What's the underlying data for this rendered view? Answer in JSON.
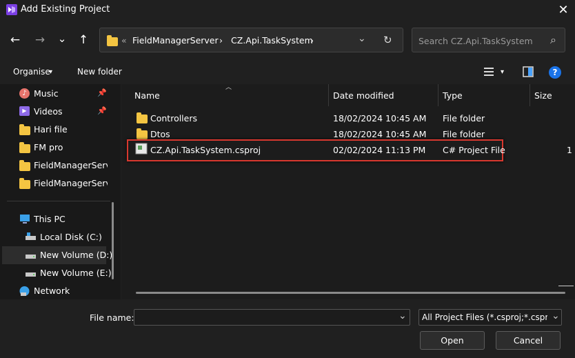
{
  "window": {
    "title": "Add Existing Project",
    "close_glyph": "✕"
  },
  "nav": {
    "back": "←",
    "forward": "→",
    "recent": "⌄",
    "up": "↑"
  },
  "address": {
    "overflow": "«",
    "crumbs": [
      "FieldManagerServer",
      "CZ.Api.TaskSystem"
    ],
    "separator": "›",
    "dropdown_glyph": "⌄",
    "refresh_glyph": "↻"
  },
  "search": {
    "placeholder": "Search CZ.Api.TaskSystem",
    "icon_glyph": "⌕"
  },
  "toolbar": {
    "organise": "Organise",
    "organise_caret": "▾",
    "new_folder": "New folder",
    "view_caret": "▾",
    "help": "?"
  },
  "sidebar": {
    "quick": [
      {
        "label": "Music",
        "icon": "music-icon",
        "pinned": true
      },
      {
        "label": "Videos",
        "icon": "videos-icon",
        "pinned": true
      },
      {
        "label": "Hari file",
        "icon": "folder-icon",
        "pinned": false
      },
      {
        "label": "FM pro",
        "icon": "folder-icon",
        "pinned": false
      },
      {
        "label": "FieldManagerServ",
        "icon": "folder-icon",
        "pinned": false
      },
      {
        "label": "FieldManagerServ",
        "icon": "folder-icon",
        "pinned": false
      }
    ],
    "this_pc": "This PC",
    "drives": [
      {
        "label": "Local Disk (C:)",
        "selected": false
      },
      {
        "label": "New Volume (D:)",
        "selected": true
      },
      {
        "label": "New Volume (E:)",
        "selected": false
      }
    ],
    "network": "Network"
  },
  "columns": {
    "name": "Name",
    "date": "Date modified",
    "type": "Type",
    "size": "Size"
  },
  "files": [
    {
      "name": "Controllers",
      "date": "18/02/2024 10:45 AM",
      "type": "File folder",
      "size": "",
      "icon": "folder-icon"
    },
    {
      "name": "Dtos",
      "date": "18/02/2024 10:45 AM",
      "type": "File folder",
      "size": "",
      "icon": "folder-icon"
    },
    {
      "name": "CZ.Api.TaskSystem.csproj",
      "date": "02/02/2024 11:13 PM",
      "type": "C# Project File",
      "size": "1",
      "icon": "csproj-file-icon",
      "highlighted": true
    }
  ],
  "footer": {
    "file_name_label": "File name:",
    "file_name_value": "",
    "filter": "All Project Files (*.csproj;*.csproj",
    "dropdown_glyph": "⌄",
    "open": "Open",
    "cancel": "Cancel"
  },
  "colors": {
    "highlight_border": "#d9382f",
    "accent": "#1a73e8",
    "folder": "#f4c542"
  }
}
